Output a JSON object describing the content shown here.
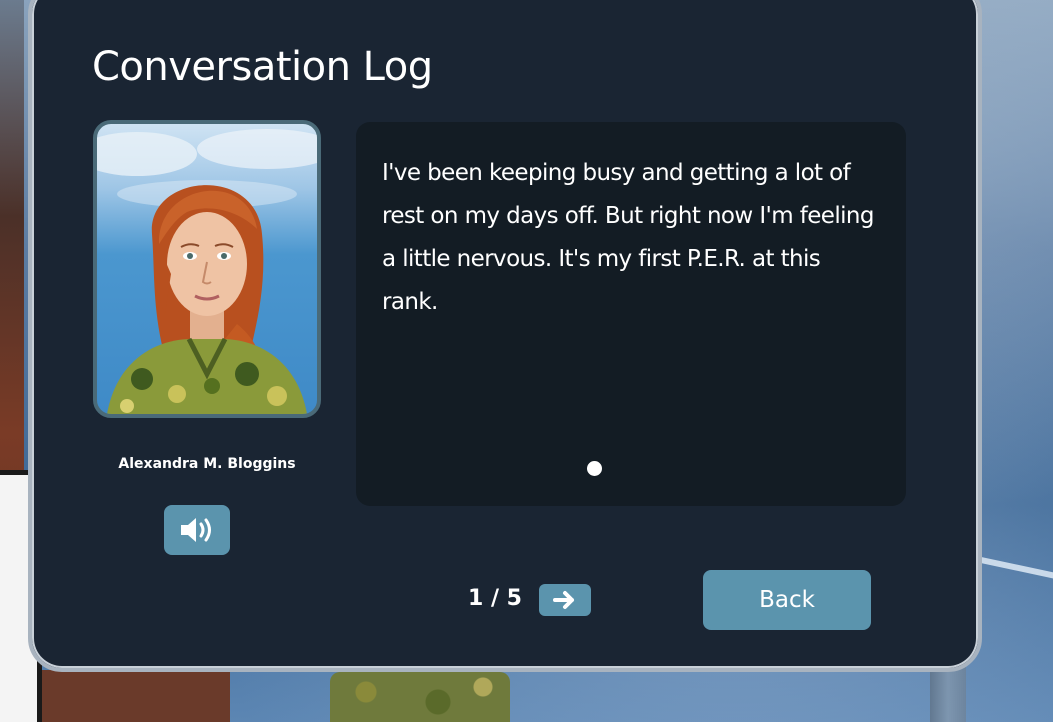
{
  "dialog": {
    "title": "Conversation Log"
  },
  "speaker": {
    "name": "Alexandra M. Bloggins",
    "audio_icon": "speaker-volume-icon"
  },
  "message": {
    "text": "I've been keeping busy and getting a lot of rest on my days off. But right now I'm feeling a little nervous. It's my first P.E.R. at this rank."
  },
  "pagination": {
    "label": "1 / 5",
    "next_icon": "arrow-right-icon"
  },
  "actions": {
    "back_label": "Back"
  },
  "colors": {
    "panel_bg": "#1a2533",
    "message_bg": "#131c24",
    "button_accent": "#5b94ad",
    "panel_border": "#a8b3bf"
  }
}
